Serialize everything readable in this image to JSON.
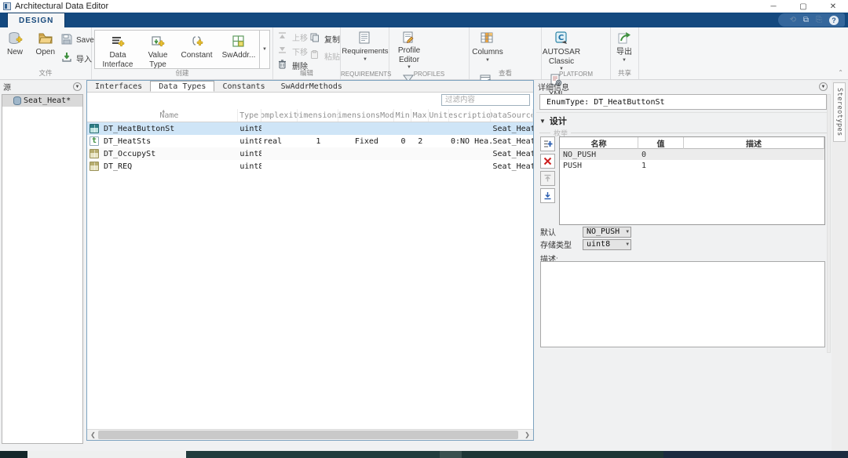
{
  "colors": {
    "accent": "#14497f",
    "selection": "#cfe5f7",
    "taskbar": "#1e3636"
  },
  "window": {
    "title": "Architectural Data Editor",
    "minimize": "─",
    "maximize": "▢",
    "close": "✕"
  },
  "ribbon": {
    "tab": "DESIGN",
    "help": "?"
  },
  "toolbar": {
    "file": {
      "label": "文件",
      "new": "New",
      "open": "Open",
      "save": "Save",
      "import": "导入"
    },
    "create": {
      "label": "创建",
      "data_interface": "Data Interface",
      "value_type": "Value Type",
      "constant": "Constant",
      "swaddr": "SwAddr..."
    },
    "edit": {
      "label": "编辑",
      "move_up": "上移",
      "move_down": "下移",
      "delete": "删除",
      "copy": "复制",
      "paste": "粘贴"
    },
    "requirements": {
      "label": "REQUIREMENTS",
      "requirements": "Requirements"
    },
    "profiles": {
      "label": "PROFILES",
      "profile_editor": "Profile Editor",
      "stereotype_filter": "Stereotype Filter"
    },
    "view": {
      "label": "查看",
      "columns": "Columns",
      "settings": "Settings"
    },
    "platform": {
      "label": "PLATFORM",
      "autosar": "AUTOSAR Classic",
      "xml_options": "XML Options"
    },
    "share": {
      "label": "共享",
      "export": "导出"
    }
  },
  "sidebar": {
    "header": "源",
    "items": [
      {
        "label": "Seat_Heat*"
      }
    ]
  },
  "main": {
    "tabs": [
      "Interfaces",
      "Data Types",
      "Constants",
      "SwAddrMethods"
    ],
    "active_tab": "Data Types",
    "filter_placeholder": "过滤内容",
    "table": {
      "columns": [
        "Name",
        "Type",
        "Complexity",
        "Dimensions",
        "DimensionsMode",
        "Min",
        "Max",
        "Unit",
        "Description",
        "DataSource"
      ],
      "rows": [
        {
          "icon": "enum-type-icon",
          "selected": true,
          "cells": [
            "DT_HeatButtonSt",
            "uint8",
            "",
            "",
            "",
            "",
            "",
            "",
            "",
            "Seat_Heat..."
          ]
        },
        {
          "icon": "value-type-icon",
          "selected": false,
          "cells": [
            "DT_HeatSts",
            "uint8",
            "real",
            "1",
            "Fixed",
            "0",
            "2",
            "",
            "0:NO Hea...",
            "Seat_Heat..."
          ]
        },
        {
          "icon": "enum-type-yellow-icon",
          "selected": false,
          "cells": [
            "DT_OccupySt",
            "uint8",
            "",
            "",
            "",
            "",
            "",
            "",
            "",
            "Seat_Heat..."
          ]
        },
        {
          "icon": "enum-type-yellow-icon",
          "selected": false,
          "cells": [
            "DT_REQ",
            "uint8",
            "",
            "",
            "",
            "",
            "",
            "",
            "",
            "Seat_Heat..."
          ]
        }
      ]
    }
  },
  "details": {
    "header": "详细信息",
    "type_line": "EnumType: DT_HeatButtonSt",
    "section": "设计",
    "enum": {
      "legend": "枚举",
      "columns": [
        "名称",
        "值",
        "描述"
      ],
      "rows": [
        {
          "cells": [
            "NO_PUSH",
            "0",
            ""
          ]
        },
        {
          "cells": [
            "PUSH",
            "1",
            ""
          ]
        }
      ]
    },
    "default_label": "默认",
    "default_value": "NO_PUSH",
    "storage_label": "存储类型",
    "storage_value": "uint8",
    "description_label": "描述:",
    "description_value": ""
  },
  "edge": {
    "stereotypes_tab": "Stereotypes"
  }
}
